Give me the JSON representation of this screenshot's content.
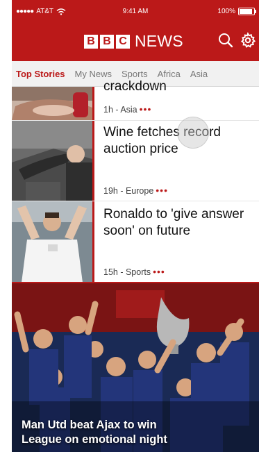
{
  "status_bar": {
    "carrier": "AT&T",
    "time": "9:41 AM",
    "battery_percent": "100%",
    "battery_level": 1.0
  },
  "header": {
    "logo_letters": [
      "B",
      "B",
      "C"
    ],
    "logo_word": "NEWS",
    "icons": [
      "search-icon",
      "gear-icon"
    ]
  },
  "tabs": [
    {
      "label": "Top Stories",
      "active": true
    },
    {
      "label": "My News"
    },
    {
      "label": "Sports"
    },
    {
      "label": "Africa"
    },
    {
      "label": "Asia"
    }
  ],
  "stories": [
    {
      "headline": "crackdown",
      "meta": "1h - Asia",
      "dots": "•••"
    },
    {
      "headline": "Wine fetches record auction price",
      "meta": "19h - Europe",
      "dots": "•••"
    },
    {
      "headline": "Ronaldo to 'give answer soon' on future",
      "meta": "15h - Sports",
      "dots": "•••"
    }
  ],
  "hero": {
    "headline_line1": "Man Utd beat Ajax to win",
    "headline_line2": "League on emotional night"
  },
  "colors": {
    "brand_red": "#bb1919",
    "tab_bg": "#f1f1f1",
    "meta_text": "#404040"
  }
}
